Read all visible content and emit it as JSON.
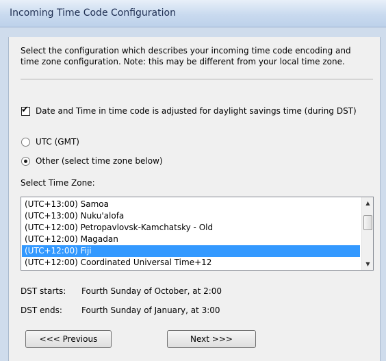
{
  "window": {
    "title": "Incoming Time Code Configuration"
  },
  "intro": {
    "line1": "Select the configuration which describes your incoming time code encoding and",
    "line2": "time zone configuration.  Note: this may be different from your local time zone."
  },
  "dst_adjust": {
    "label": "Date and Time in time code is adjusted for daylight savings time (during DST)",
    "checked": true
  },
  "radios": {
    "utc": {
      "label": "UTC (GMT)",
      "selected": false
    },
    "other": {
      "label": "Other (select time zone below)",
      "selected": true
    }
  },
  "timezone": {
    "label": "Select Time Zone:",
    "items": [
      "(UTC+13:00) Samoa",
      "(UTC+13:00) Nuku'alofa",
      "(UTC+12:00) Petropavlovsk-Kamchatsky - Old",
      "(UTC+12:00) Magadan",
      "(UTC+12:00) Fiji",
      "(UTC+12:00) Coordinated Universal Time+12"
    ],
    "selected_index": 4
  },
  "dst_info": {
    "starts_key": "DST starts:",
    "starts_value": "Fourth Sunday of October, at 2:00",
    "ends_key": "DST ends:",
    "ends_value": "Fourth Sunday of January, at 3:00"
  },
  "buttons": {
    "previous": "<<< Previous",
    "next": "Next >>>"
  },
  "colors": {
    "selection": "#3399ff",
    "title_text": "#1e2e52"
  }
}
